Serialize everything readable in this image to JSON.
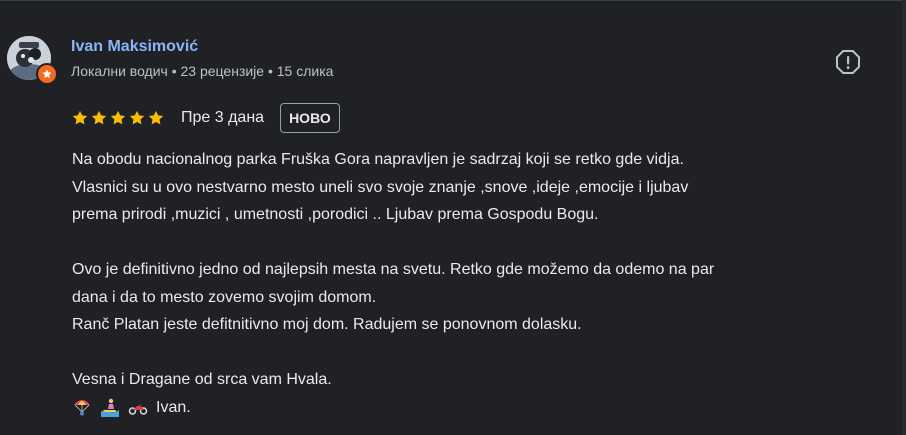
{
  "reviewer": {
    "name": "Ivan Maksimović",
    "meta": "Локални водич • 23 рецензије • 15 слика"
  },
  "review": {
    "rating": 5,
    "rating_max": 5,
    "date": "Пре 3 дана",
    "new_badge": "НОВО",
    "paragraphs": [
      "Na obodu nacionalnog parka Fruška Gora napravljen je sadrzaj koji se retko gde vidja.",
      "Vlasnici su u ovo nestvarno mesto uneli svo svoje znanje ,snove ,ideje ,emocije i ljubav",
      "premа prirodi ,muzici , umetnosti ,porodici .. Ljubav prema Gospodu Bogu.",
      "Ovo je definitivno jedno od najlepsih mesta na svetu. Retko gde možemo da odemo na par",
      "dana i da to mesto zovemo svojim domom.",
      "Ranč Platan jeste defitnitivno moj dom. Radujem se ponovnom dolasku.",
      "Vesna i Dragane od srca vam Hvala.",
      "Ivan."
    ]
  },
  "icons": {
    "avatar": "avatar-image",
    "local_guide_badge": "local-guide-star-icon",
    "report": "report-flag-icon",
    "star": "star-icon",
    "emojis": [
      "parachute-emoji",
      "surfer-emoji",
      "motorcycle-emoji"
    ]
  },
  "colors": {
    "background": "#202124",
    "name_link": "#8ab4f8",
    "star": "#fbbc04",
    "badge": "#f26b21",
    "text": "#e8eaed",
    "muted": "#bdc1c6"
  }
}
